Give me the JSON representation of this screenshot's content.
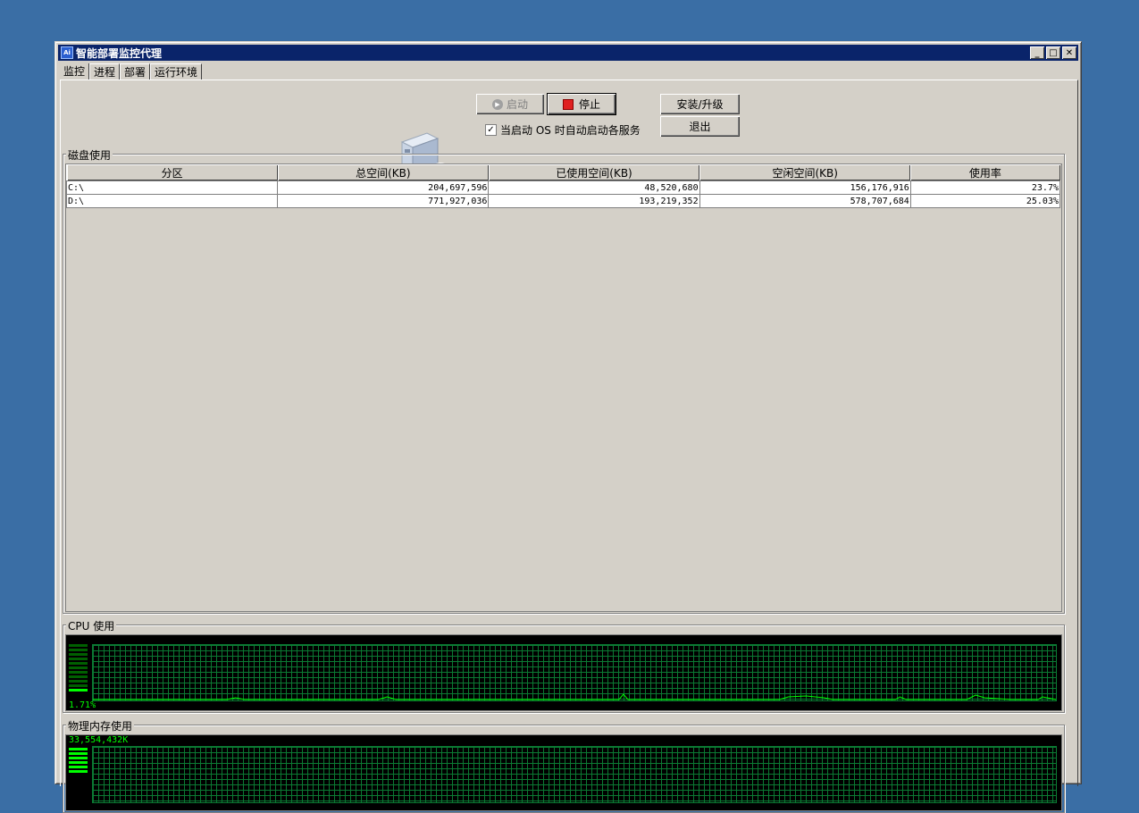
{
  "window": {
    "title": "智能部署监控代理"
  },
  "tabs": [
    {
      "label": "监控"
    },
    {
      "label": "进程"
    },
    {
      "label": "部署"
    },
    {
      "label": "运行环境"
    }
  ],
  "controls": {
    "start_label": "启动",
    "stop_label": "停止",
    "install_label": "安装/升级",
    "exit_label": "退出",
    "autostart_label": "当启动 OS 时自动启动各服务",
    "autostart_checked": true
  },
  "disk": {
    "group_label": "磁盘使用",
    "columns": [
      "分区",
      "总空间(KB)",
      "已使用空间(KB)",
      "空闲空间(KB)",
      "使用率"
    ],
    "rows": [
      [
        "C:\\",
        "204,697,596",
        "48,520,680",
        "156,176,916",
        "23.7%"
      ],
      [
        "D:\\",
        "771,927,036",
        "193,219,352",
        "578,707,684",
        "25.03%"
      ]
    ]
  },
  "cpu": {
    "group_label": "CPU 使用",
    "value_text": "1.71%",
    "level": 0.0171
  },
  "memory": {
    "group_label": "物理内存使用",
    "value_text": "33,554,432K"
  },
  "colors": {
    "desktop": "#3a6ea5",
    "titlebar": "#0a246a",
    "face": "#d4d0c8",
    "graph_green": "#00ff00"
  }
}
